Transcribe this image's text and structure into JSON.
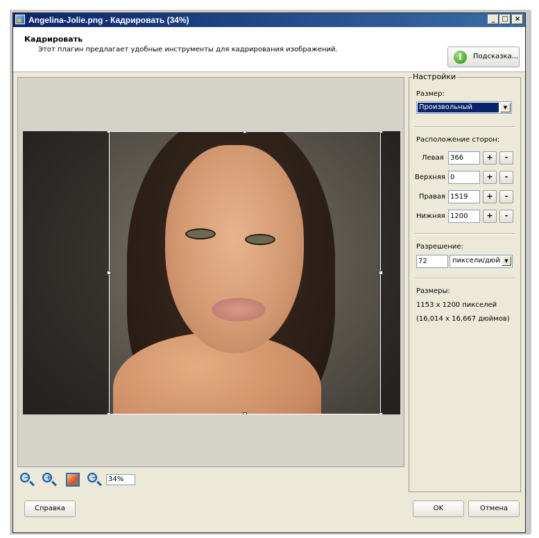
{
  "window": {
    "title": "Angelina-Jolie.png - Кадрировать (34%)",
    "min": "_",
    "max": "□",
    "close": "×"
  },
  "header": {
    "title": "Кадрировать",
    "description": "Этот плагин предлагает удобные инструменты для кадрирования изображений.",
    "hint_label": "Подсказка...",
    "hint_icon_glyph": "i"
  },
  "zoom": {
    "value": "34%"
  },
  "settings": {
    "title": "Настройки",
    "size_label": "Размер:",
    "size_value": "Произвольный",
    "sides_label": "Расположение сторон:",
    "left_label": "Левая",
    "left_value": "366",
    "top_label": "Верхняя",
    "top_value": "0",
    "right_label": "Правая",
    "right_value": "1519",
    "bottom_label": "Нижняя",
    "bottom_value": "1200",
    "plus": "+",
    "minus": "-",
    "resolution_label": "Разрешение:",
    "resolution_value": "72",
    "resolution_unit": "пиксели/дюйм",
    "dims_label": "Размеры:",
    "dims_pixels": "1153 x 1200 пикселей",
    "dims_inches": "(16,014 x 16,667 дюймов)"
  },
  "footer": {
    "help": "Справка",
    "ok": "OK",
    "cancel": "Отмена"
  }
}
